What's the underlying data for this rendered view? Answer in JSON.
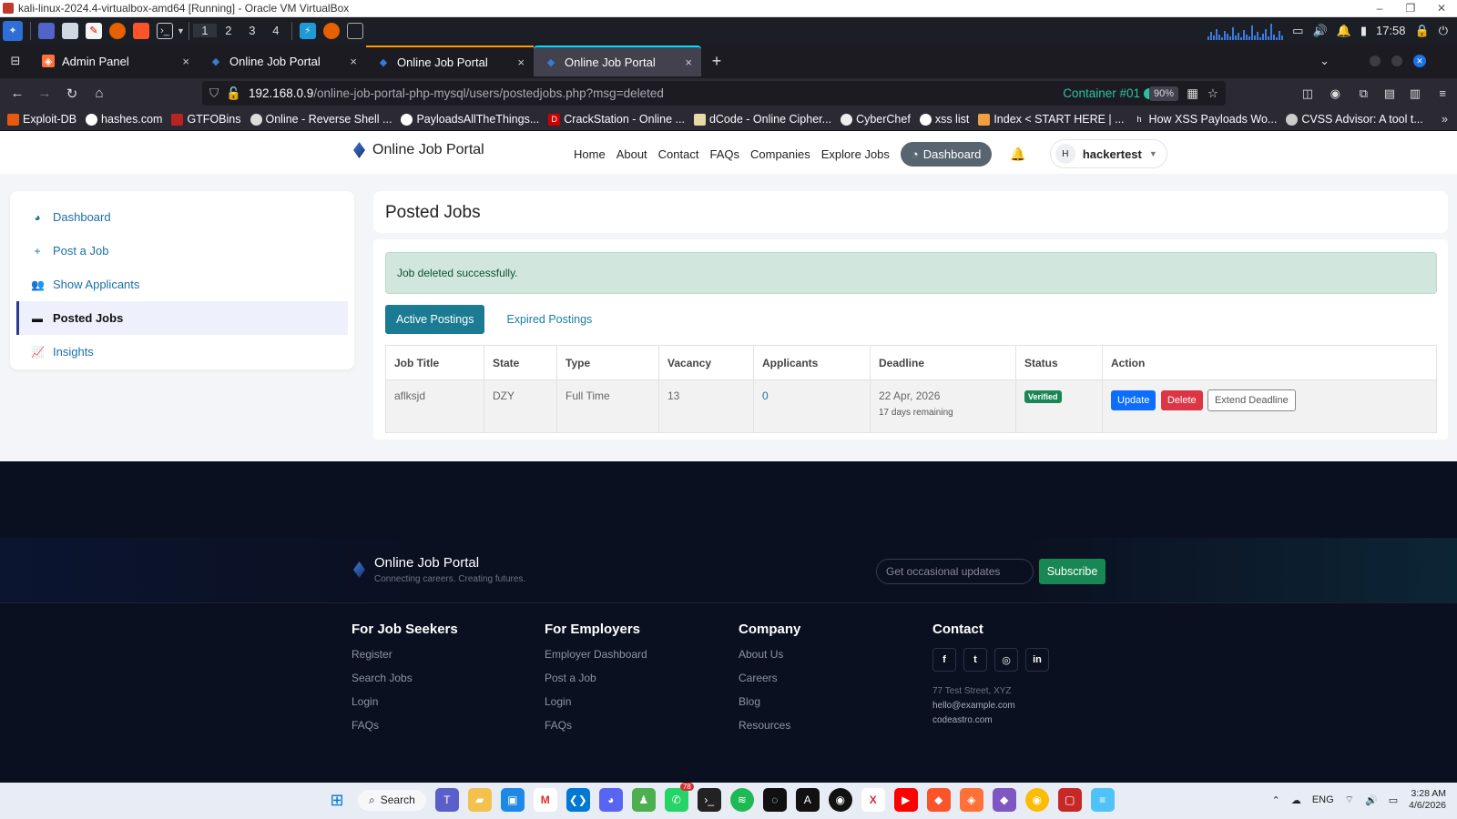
{
  "vm": {
    "title": "kali-linux-2024.4-virtualbox-amd64 [Running] - Oracle VM VirtualBox",
    "controls": [
      "–",
      "❐",
      "✕"
    ]
  },
  "panel": {
    "workspaces": [
      "1",
      "2",
      "3",
      "4"
    ],
    "time": "17:58"
  },
  "tabs": [
    {
      "label": "Admin Panel",
      "close": "×"
    },
    {
      "label": "Online Job Portal",
      "close": "×"
    },
    {
      "label": "Online Job Portal",
      "close": "×"
    },
    {
      "label": "Online Job Portal",
      "close": "×"
    }
  ],
  "newtab": "+",
  "url": {
    "host": "192.168.0.9",
    "path": "/online-job-portal-php-mysql/users/postedjobs.php?msg=deleted",
    "container": "Container #01",
    "zoom": "90%"
  },
  "bookmarks": [
    "Exploit-DB",
    "hashes.com",
    "GTFOBins",
    "Online - Reverse Shell ...",
    "PayloadsAllTheThings...",
    "CrackStation - Online ...",
    "dCode - Online Cipher...",
    "CyberChef",
    "xss list",
    "Index < START HERE | ...",
    "How XSS Payloads Wo...",
    "CVSS Advisor: A tool t..."
  ],
  "site": {
    "brand": "Online Job Portal",
    "menu": [
      "Home",
      "About",
      "Contact",
      "FAQs",
      "Companies",
      "Explore Jobs"
    ],
    "dashboard": "Dashboard",
    "user": {
      "initial": "H",
      "name": "hackertest"
    }
  },
  "sidebar": [
    {
      "label": "Dashboard",
      "icon": "gauge-icon"
    },
    {
      "label": "Post a Job",
      "icon": "plus-icon"
    },
    {
      "label": "Show Applicants",
      "icon": "users-icon"
    },
    {
      "label": "Posted Jobs",
      "icon": "briefcase-icon"
    },
    {
      "label": "Insights",
      "icon": "chart-icon"
    }
  ],
  "main": {
    "title": "Posted Jobs",
    "alert": "Job deleted successfully.",
    "tabs": [
      "Active Postings",
      "Expired Postings"
    ],
    "columns": [
      "Job Title",
      "State",
      "Type",
      "Vacancy",
      "Applicants",
      "Deadline",
      "Status",
      "Action"
    ],
    "rows": [
      {
        "title": "aflksjd",
        "state": "DZY",
        "type": "Full Time",
        "vacancy": "13",
        "applicants": "0",
        "deadline": "22 Apr, 2026",
        "remaining": "17 days remaining",
        "status": "Verified"
      }
    ],
    "actions": [
      "Update",
      "Delete",
      "Extend Deadline"
    ]
  },
  "footer": {
    "brand": "Online Job Portal",
    "tagline": "Connecting careers. Creating futures.",
    "subscribe_placeholder": "Get occasional updates",
    "subscribe": "Subscribe",
    "columns": [
      {
        "title": "For Job Seekers",
        "links": [
          "Register",
          "Search Jobs",
          "Login",
          "FAQs"
        ]
      },
      {
        "title": "For Employers",
        "links": [
          "Employer Dashboard",
          "Post a Job",
          "Login",
          "FAQs"
        ]
      },
      {
        "title": "Company",
        "links": [
          "About Us",
          "Careers",
          "Blog",
          "Resources"
        ]
      }
    ],
    "contact": {
      "title": "Contact",
      "social": [
        "f",
        "t",
        "◎",
        "in"
      ],
      "lines": [
        "77 Test Street, XYZ",
        "hello@example.com",
        "codeastro.com"
      ]
    }
  },
  "taskbar": {
    "search": "Search",
    "badge": "78",
    "lang": "ENG",
    "time": "3:28 AM",
    "date": "4/6/2026"
  }
}
